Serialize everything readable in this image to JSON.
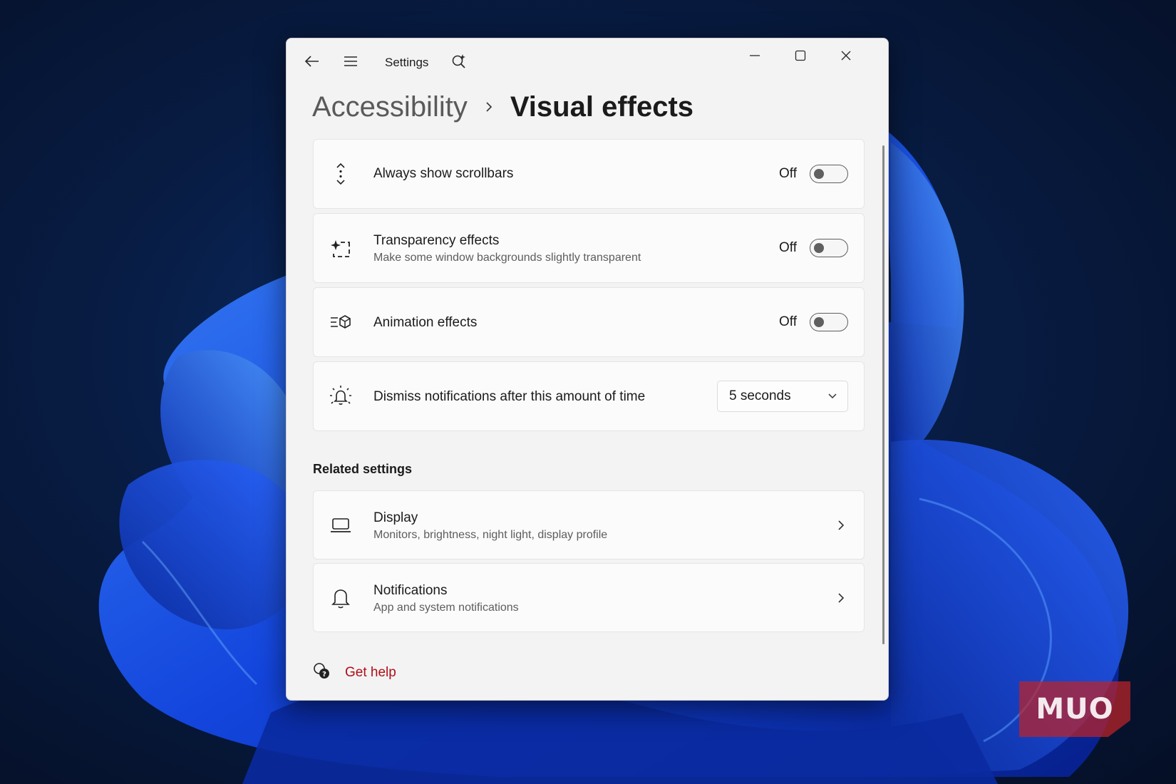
{
  "window": {
    "app_title": "Settings"
  },
  "breadcrumb": {
    "parent": "Accessibility",
    "current": "Visual effects"
  },
  "settings": [
    {
      "title": "Always show scrollbars",
      "subtitle": "",
      "state_label": "Off",
      "on": false,
      "icon": "scrollbar-icon"
    },
    {
      "title": "Transparency effects",
      "subtitle": "Make some window backgrounds slightly transparent",
      "state_label": "Off",
      "on": false,
      "icon": "transparency-icon"
    },
    {
      "title": "Animation effects",
      "subtitle": "",
      "state_label": "Off",
      "on": false,
      "icon": "animation-icon"
    },
    {
      "title": "Dismiss notifications after this amount of time",
      "subtitle": "",
      "selected": "5 seconds",
      "icon": "notification-timer-icon"
    }
  ],
  "related": {
    "title": "Related settings",
    "items": [
      {
        "title": "Display",
        "subtitle": "Monitors, brightness, night light, display profile",
        "icon": "laptop-icon"
      },
      {
        "title": "Notifications",
        "subtitle": "App and system notifications",
        "icon": "bell-icon"
      }
    ]
  },
  "help": {
    "label": "Get help",
    "icon": "help-icon"
  },
  "watermark": {
    "text": "MUO"
  },
  "colors": {
    "accent_link": "#b00d18",
    "window_bg": "#f3f3f3",
    "card_bg": "#fbfbfb",
    "desktop_bg": "#081d45",
    "bloom_blue": "#1e5cff"
  }
}
